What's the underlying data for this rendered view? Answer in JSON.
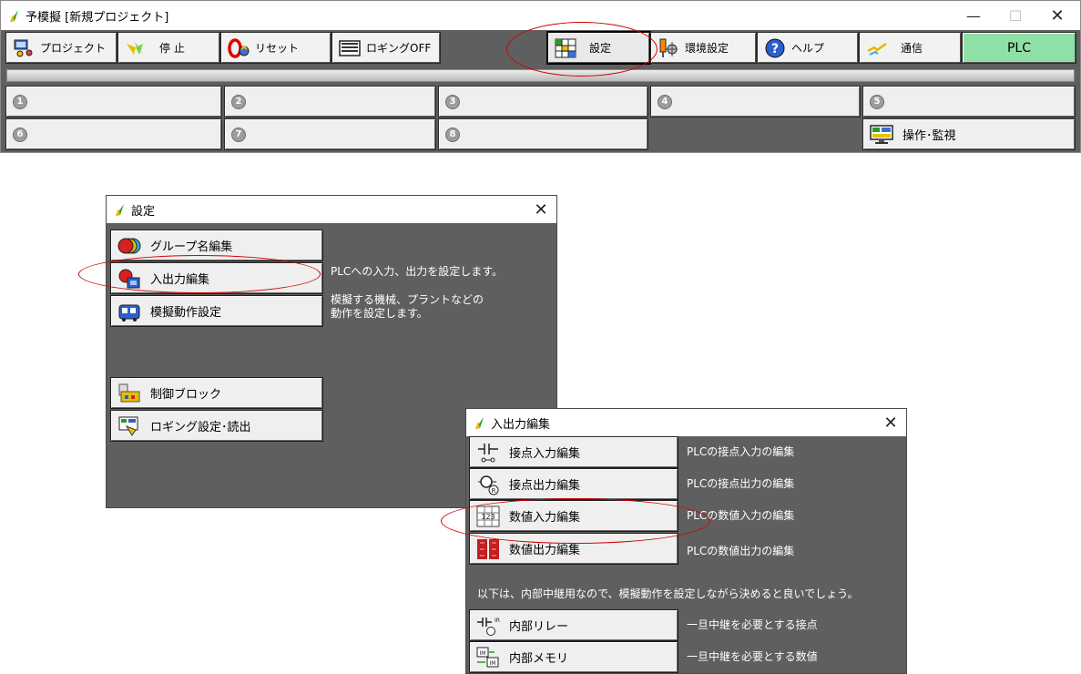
{
  "main_window": {
    "title": "予模擬  [新規プロジェクト]",
    "controls": {
      "minimize": "—",
      "maximize": "☐",
      "close": "✕"
    },
    "toolbar": [
      {
        "label": "プロジェクト",
        "icon": "project-icon"
      },
      {
        "label": "停 止",
        "icon": "stop-icon"
      },
      {
        "label": "リセット",
        "icon": "reset-icon"
      },
      {
        "label": "ロギングOFF",
        "icon": "logging-icon"
      },
      {
        "label": "設定",
        "icon": "settings-grid-icon"
      },
      {
        "label": "環境設定",
        "icon": "environment-icon"
      },
      {
        "label": "ヘルプ",
        "icon": "help-icon"
      },
      {
        "label": "通信",
        "icon": "communication-icon"
      },
      {
        "label": "PLC"
      }
    ],
    "groups": [
      "1",
      "2",
      "3",
      "4",
      "5",
      "6",
      "7",
      "8"
    ],
    "monitor_button": {
      "label": "操作･監視",
      "icon": "monitor-icon"
    }
  },
  "settings_dialog": {
    "title": "設定",
    "close": "✕",
    "buttons": [
      {
        "label": "グループ名編集",
        "icon": "group-name-icon"
      },
      {
        "label": "入出力編集",
        "icon": "io-edit-icon"
      },
      {
        "label": "模擬動作設定",
        "icon": "simulation-icon"
      },
      {
        "label": "制御ブロック",
        "icon": "control-block-icon"
      },
      {
        "label": "ロギング設定･読出",
        "icon": "logging-settings-icon"
      }
    ],
    "descriptions": {
      "io": "PLCへの入力、出力を設定します。",
      "sim_line1": "模擬する機械、プラントなどの",
      "sim_line2": "動作を設定します。"
    }
  },
  "io_dialog": {
    "title": "入出力編集",
    "close": "✕",
    "rows": [
      {
        "label": "接点入力編集",
        "desc": "PLCの接点入力の編集",
        "icon": "contact-input-icon"
      },
      {
        "label": "接点出力編集",
        "desc": "PLCの接点出力の編集",
        "icon": "contact-output-icon"
      },
      {
        "label": "数値入力編集",
        "desc": "PLCの数値入力の編集",
        "icon": "numeric-input-icon"
      },
      {
        "label": "数値出力編集",
        "desc": "PLCの数値出力の編集",
        "icon": "numeric-output-icon"
      }
    ],
    "note": "以下は、内部中継用なので、模擬動作を設定しながら決めると良いでしょう。",
    "internal_rows": [
      {
        "label": "内部リレー",
        "desc": "一旦中継を必要とする接点",
        "icon": "internal-relay-icon"
      },
      {
        "label": "内部メモリ",
        "desc": "一旦中継を必要とする数値",
        "icon": "internal-memory-icon"
      }
    ]
  },
  "colors": {
    "window_bg": "#5f5f5f",
    "button_bg": "#efefef",
    "plc_green": "#8fe0a6",
    "annotation_red": "#d40000"
  }
}
